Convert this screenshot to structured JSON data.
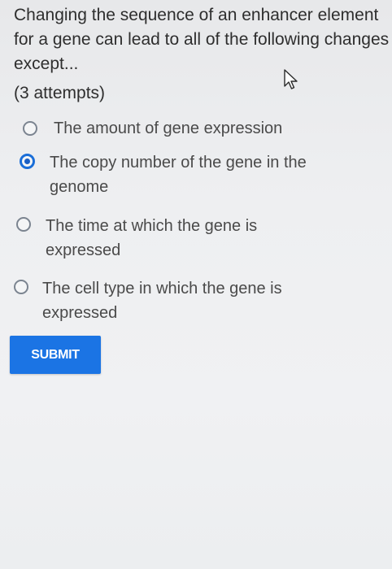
{
  "question": {
    "text": "Changing the sequence of an enhancer element for a gene can lead to all of the following changes except...",
    "attempts": "(3 attempts)"
  },
  "options": [
    {
      "label": "The amount of gene expression",
      "selected": false
    },
    {
      "label": "The copy number of the gene in the genome",
      "selected": true
    },
    {
      "label": "The time at which the gene is expressed",
      "selected": false
    },
    {
      "label": "The cell type in which the gene is expressed",
      "selected": false
    }
  ],
  "submit": {
    "label": "SUBMIT"
  },
  "colors": {
    "accent": "#1b74e4",
    "text": "#2e2e2e",
    "radio_border": "#7b8490"
  },
  "icons": {
    "cursor": "mouse-pointer-icon"
  }
}
